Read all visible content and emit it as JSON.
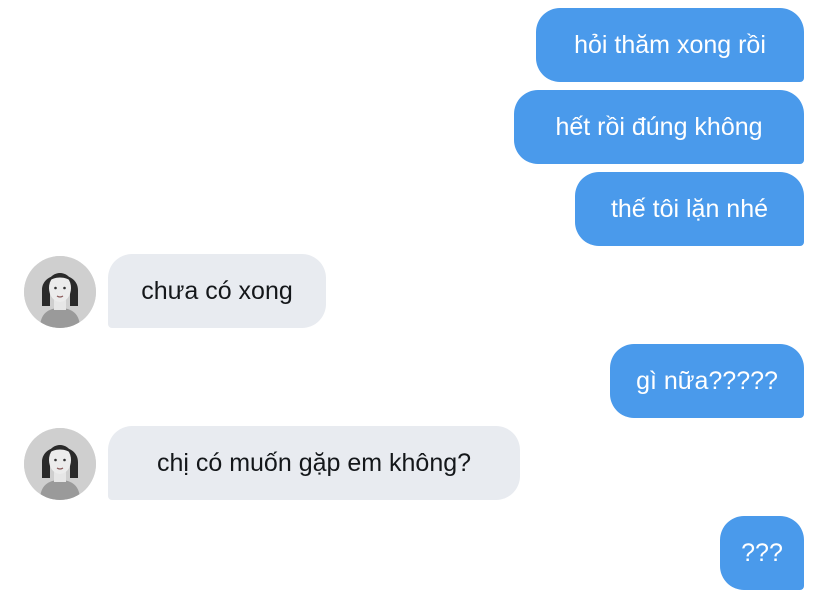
{
  "conversation": {
    "messages": [
      {
        "direction": "outgoing",
        "text": "hỏi thăm xong rồi"
      },
      {
        "direction": "outgoing",
        "text": "hết rồi đúng không"
      },
      {
        "direction": "outgoing",
        "text": "thế tôi lặn nhé"
      },
      {
        "direction": "incoming",
        "text": "chưa có xong"
      },
      {
        "direction": "outgoing",
        "text": "gì nữa?????"
      },
      {
        "direction": "incoming",
        "text": "chị có muốn gặp em không?"
      },
      {
        "direction": "outgoing",
        "text": "???"
      }
    ]
  },
  "colors": {
    "outgoing_bubble": "#4a9aeb",
    "incoming_bubble": "#e8ebf0",
    "background": "#ffffff"
  },
  "icons": {
    "contact_avatar": "avatar-photo-icon"
  }
}
